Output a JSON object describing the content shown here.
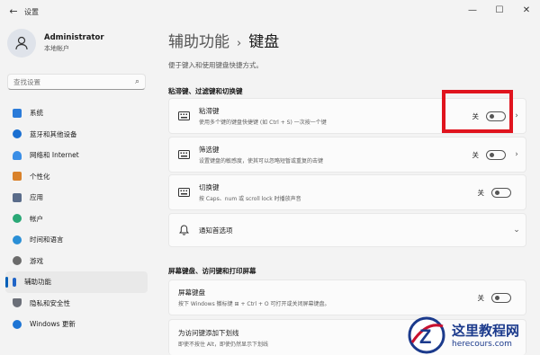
{
  "window": {
    "back_icon": "back-arrow-icon",
    "title": "设置",
    "minimize": "—",
    "maximize": "☐",
    "close": "✕"
  },
  "user": {
    "name": "Administrator",
    "role": "本地帐户"
  },
  "search": {
    "placeholder": "查找设置"
  },
  "nav": [
    {
      "label": "系统",
      "icon": "system-icon",
      "color": "#2b7bd9"
    },
    {
      "label": "蓝牙和其他设备",
      "icon": "bluetooth-icon",
      "color": "#1a6fd1"
    },
    {
      "label": "网络和 Internet",
      "icon": "network-icon",
      "color": "#3a8ee6"
    },
    {
      "label": "个性化",
      "icon": "brush-icon",
      "color": "#d9822b"
    },
    {
      "label": "应用",
      "icon": "apps-icon",
      "color": "#5a6c8a"
    },
    {
      "label": "帐户",
      "icon": "account-icon",
      "color": "#2aa876"
    },
    {
      "label": "时间和语言",
      "icon": "globe-icon",
      "color": "#2a8fd6"
    },
    {
      "label": "游戏",
      "icon": "game-icon",
      "color": "#6b6b6b"
    },
    {
      "label": "辅助功能",
      "icon": "accessibility-icon",
      "color": "#1f64c7"
    },
    {
      "label": "隐私和安全性",
      "icon": "shield-icon",
      "color": "#6b6f78"
    },
    {
      "label": "Windows 更新",
      "icon": "update-icon",
      "color": "#1d74d4"
    }
  ],
  "main": {
    "breadcrumb_parent": "辅助功能",
    "breadcrumb_sep": "›",
    "breadcrumb_current": "键盘",
    "description": "便于键入和使用键盘快捷方式。",
    "section1": "粘滞键、过滤键和切换键",
    "section2": "屏幕键盘、访问键和打印屏幕",
    "sticky": {
      "title": "粘滞键",
      "subtitle": "使用多个键的键盘快捷键 (如 Ctrl + S) 一次按一个键",
      "state": "关"
    },
    "filter": {
      "title": "筛选键",
      "subtitle": "设置键盘的敏感度，使其可以忽略短暂或重复的击键",
      "state": "关"
    },
    "toggle_keys": {
      "title": "切换键",
      "subtitle": "按 Caps、num 或 scroll lock 时播放声音",
      "state": "关"
    },
    "notify": {
      "title": "通知首选项"
    },
    "osk": {
      "title": "屏幕键盘",
      "subtitle": "按下 Windows 徽标键 ⊞ + Ctrl + O 可打开或关闭屏幕键盘。",
      "state": "关"
    },
    "underline": {
      "title": "为访问键添加下划线",
      "subtitle": "即使不按住 Alt，即使仍然显示下划线"
    }
  },
  "watermark": {
    "title": "这里教程网",
    "url": "herecours.com",
    "letter": "Z"
  },
  "colors": {
    "accent": "#005fb8",
    "highlight": "#e0141e"
  }
}
